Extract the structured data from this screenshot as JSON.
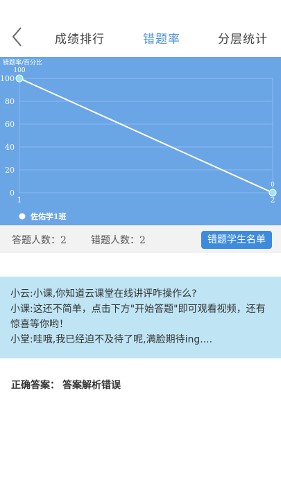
{
  "header": {
    "tabs": [
      {
        "label": "成绩排行"
      },
      {
        "label": "错题率"
      },
      {
        "label": "分层统计"
      }
    ],
    "active_tab": 1
  },
  "chart_data": {
    "type": "line",
    "ylabel": "错题率/百分比",
    "x": [
      1,
      2
    ],
    "ylim": [
      0,
      100
    ],
    "yticks": [
      0,
      20,
      40,
      60,
      80,
      100
    ],
    "xticks": [
      1,
      2
    ],
    "series": [
      {
        "name": "佐佑学1班",
        "values": [
          100,
          0
        ]
      }
    ],
    "data_labels": [
      "100",
      "0"
    ],
    "legend_position": "bottom-left",
    "colors": {
      "background": "#6aa5e6",
      "line": "#ffffff",
      "point": "#9fe3f5",
      "grid": "#8dbbed"
    }
  },
  "stats": {
    "answered": "答题人数：2",
    "wrong": "错题人数：2",
    "wrong_list_button": "错题学生名单"
  },
  "dialog": {
    "line1": "小云:小课,你知道云课堂在线讲评咋操作么?",
    "line2": "小课:这还不简单，点击下方\"开始答题\"即可观看视频，还有惊喜等你哟！",
    "line3": "小堂:哇哦,我已经迫不及待了呢,满脸期待ing...."
  },
  "answer": {
    "label": "正确答案：",
    "value": "答案解析错误"
  }
}
